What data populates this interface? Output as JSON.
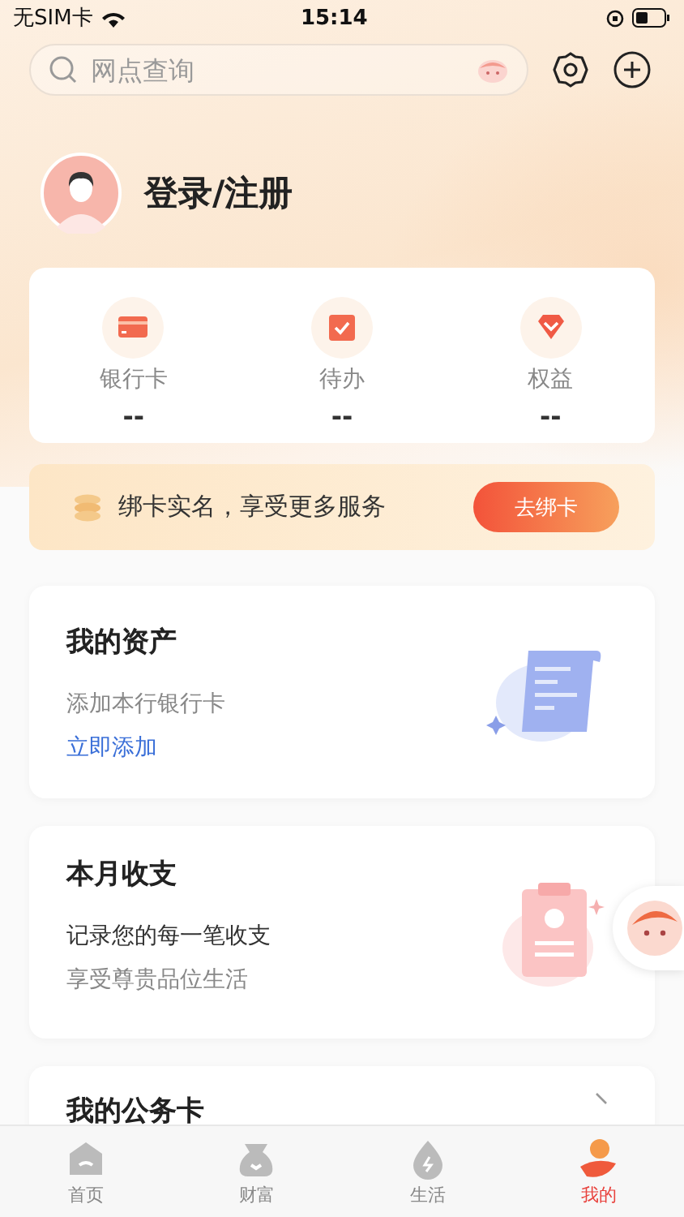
{
  "status_bar": {
    "carrier": "无SIM卡",
    "time": "15:14"
  },
  "search": {
    "placeholder": "网点查询"
  },
  "profile": {
    "name": "登录/注册"
  },
  "stats": [
    {
      "label": "银行卡",
      "value": "--",
      "kind": "card"
    },
    {
      "label": "待办",
      "value": "--",
      "kind": "todo"
    },
    {
      "label": "权益",
      "value": "--",
      "kind": "gem"
    }
  ],
  "bind_banner": {
    "text": "绑卡实名，享受更多服务",
    "button": "去绑卡"
  },
  "cards": [
    {
      "title": "我的资产",
      "line1": "添加本行银行卡",
      "link": "立即添加",
      "kind": "asset"
    },
    {
      "title": "本月收支",
      "line1": "记录您的每一笔收支",
      "line2": "享受尊贵品位生活",
      "kind": "budget"
    },
    {
      "title": "我的公务卡",
      "kind": "plain"
    }
  ],
  "tabs": [
    {
      "label": "首页",
      "selected": false,
      "kind": "home"
    },
    {
      "label": "财富",
      "selected": false,
      "kind": "wealth"
    },
    {
      "label": "生活",
      "selected": false,
      "kind": "life"
    },
    {
      "label": "我的",
      "selected": true,
      "kind": "me"
    }
  ]
}
